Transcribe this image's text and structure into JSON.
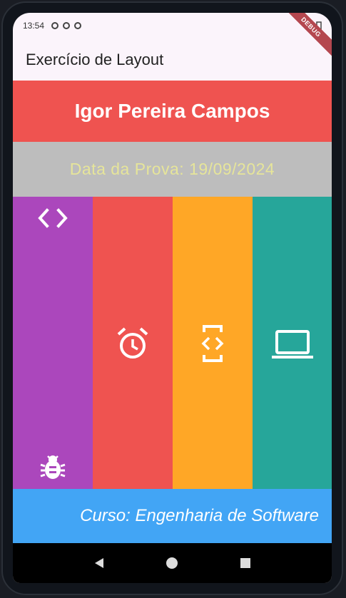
{
  "status_bar": {
    "time": "13:54"
  },
  "debug_banner": "DEBUG",
  "app_bar": {
    "title": "Exercício de Layout"
  },
  "header": {
    "name": "Igor Pereira Campos"
  },
  "date_bar": {
    "text": "Data da Prova: 19/09/2024"
  },
  "columns": [
    {
      "color": "#ab47bc",
      "icons": [
        "code-icon",
        "bug-icon"
      ]
    },
    {
      "color": "#ef5350",
      "icons": [
        "alarm-icon"
      ]
    },
    {
      "color": "#ffa726",
      "icons": [
        "developer-mode-icon"
      ]
    },
    {
      "color": "#26a69a",
      "icons": [
        "laptop-icon"
      ]
    }
  ],
  "footer": {
    "course": "Curso: Engenharia de Software"
  },
  "navigation": {
    "buttons": [
      "back-icon",
      "home-icon",
      "recents-icon"
    ]
  }
}
